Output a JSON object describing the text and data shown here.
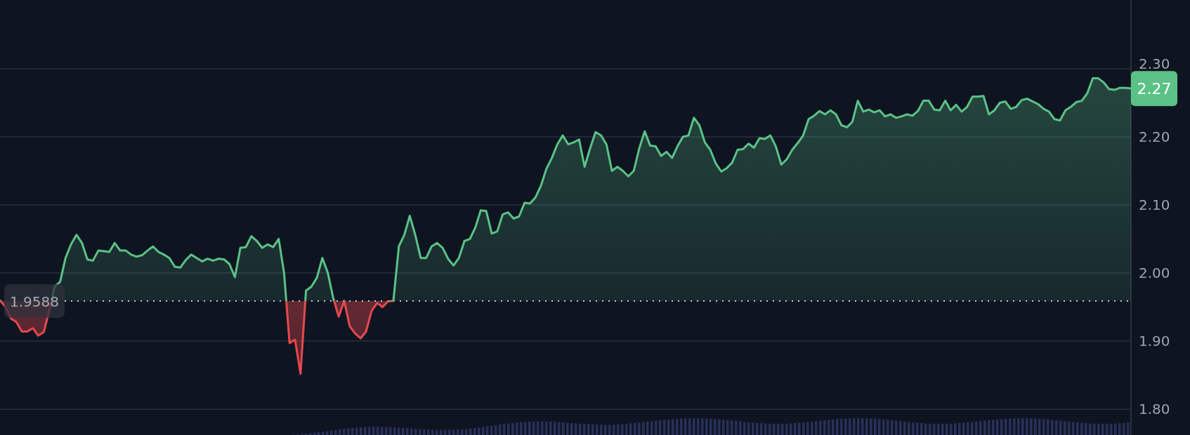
{
  "chart": {
    "chart_data": {
      "type": "area",
      "grid": true,
      "ref_lines": [
        {
          "axis": "y",
          "value": 1.9588,
          "label": "1.9588"
        }
      ],
      "series": [
        {
          "color": "#5ac286",
          "values": [
            1.96,
            1.95,
            1.933,
            1.928,
            1.914,
            1.914,
            1.919,
            1.908,
            1.913,
            1.944,
            1.98,
            1.987,
            2.022,
            2.042,
            2.056,
            2.044,
            2.02,
            2.018,
            2.033,
            2.032,
            2.031,
            2.044,
            2.033,
            2.033,
            2.027,
            2.024,
            2.026,
            2.033,
            2.039,
            2.031,
            2.027,
            2.022,
            2.009,
            2.008,
            2.019,
            2.027,
            2.022,
            2.017,
            2.021,
            2.018,
            2.021,
            2.02,
            2.013,
            1.994,
            2.037,
            2.038,
            2.054,
            2.047,
            2.037,
            2.042,
            2.038,
            2.05,
            2.0,
            1.897,
            1.902,
            1.852,
            1.974,
            1.98,
            1.993,
            2.022,
            2.0,
            1.963,
            1.936,
            1.959,
            1.922,
            1.911,
            1.904,
            1.914,
            1.944,
            1.956,
            1.95,
            1.958,
            1.959,
            2.039,
            2.056,
            2.084,
            2.056,
            2.022,
            2.022,
            2.039,
            2.044,
            2.037,
            2.021,
            2.011,
            2.022,
            2.047,
            2.05,
            2.067,
            2.092,
            2.091,
            2.058,
            2.061,
            2.086,
            2.089,
            2.08,
            2.083,
            2.103,
            2.102,
            2.111,
            2.128,
            2.153,
            2.169,
            2.189,
            2.202,
            2.189,
            2.192,
            2.196,
            2.156,
            2.183,
            2.207,
            2.202,
            2.189,
            2.15,
            2.156,
            2.15,
            2.142,
            2.15,
            2.183,
            2.208,
            2.187,
            2.186,
            2.172,
            2.178,
            2.169,
            2.186,
            2.2,
            2.202,
            2.228,
            2.217,
            2.192,
            2.181,
            2.161,
            2.149,
            2.154,
            2.162,
            2.181,
            2.182,
            2.19,
            2.184,
            2.198,
            2.197,
            2.202,
            2.186,
            2.159,
            2.167,
            2.181,
            2.191,
            2.202,
            2.226,
            2.231,
            2.238,
            2.233,
            2.239,
            2.233,
            2.217,
            2.214,
            2.222,
            2.253,
            2.237,
            2.24,
            2.236,
            2.239,
            2.23,
            2.233,
            2.228,
            2.23,
            2.233,
            2.231,
            2.238,
            2.253,
            2.253,
            2.24,
            2.239,
            2.253,
            2.239,
            2.247,
            2.237,
            2.244,
            2.259,
            2.259,
            2.26,
            2.233,
            2.239,
            2.25,
            2.252,
            2.241,
            2.244,
            2.254,
            2.256,
            2.252,
            2.248,
            2.241,
            2.237,
            2.226,
            2.224,
            2.239,
            2.244,
            2.251,
            2.253,
            2.264,
            2.286,
            2.286,
            2.28,
            2.27,
            2.269,
            2.272,
            2.272,
            2.271
          ]
        }
      ],
      "ylim": [
        1.762,
        2.401
      ],
      "yticks": [
        {
          "value": 2.3,
          "label": "2.30"
        },
        {
          "value": 2.2,
          "label": "2.20"
        },
        {
          "value": 2.1,
          "label": "2.10"
        },
        {
          "value": 2.0,
          "label": "2.00"
        },
        {
          "value": 1.9,
          "label": "1.90"
        },
        {
          "value": 1.8,
          "label": "1.80"
        }
      ]
    },
    "last_price": {
      "label": "2.27"
    }
  }
}
